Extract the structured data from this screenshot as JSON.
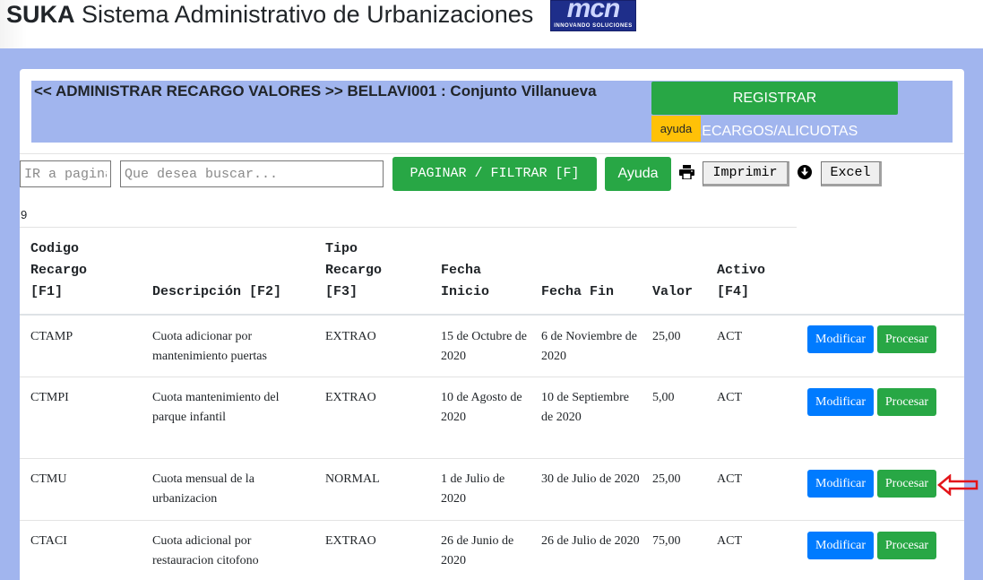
{
  "header": {
    "brand": "SUKA",
    "title": "Sistema Administrativo de Urbanizaciones",
    "logo_mark": "mcn",
    "logo_text": "INNOVANDO SOLUCIONES"
  },
  "banner": {
    "title": "<< ADMINISTRAR RECARGO VALORES >> BELLAVI001 : Conjunto Villanueva",
    "register_button": "REGISTRAR RECARGOS/ALICUOTAS",
    "help_badge": "ayuda"
  },
  "toolbar": {
    "page_placeholder": "IR a pagina",
    "search_placeholder": "Que desea buscar...",
    "paginate_button": "PAGINAR / FILTRAR [F]",
    "help_button": "Ayuda",
    "print_button": "Imprimir",
    "excel_button": "Excel"
  },
  "record_count": "9",
  "table": {
    "headers": {
      "codigo": [
        "Codigo",
        "Recargo",
        "[F1]"
      ],
      "descripcion": "Descripción [F2]",
      "tipo": [
        "Tipo",
        "Recargo",
        "[F3]"
      ],
      "fecha_inicio": [
        "Fecha",
        "Inicio"
      ],
      "fecha_fin": "Fecha Fin",
      "valor": "Valor",
      "activo": [
        "Activo",
        "[F4]"
      ]
    },
    "rows": [
      {
        "codigo": "CTAMP",
        "descripcion": "Cuota adicionar por mantenimiento puertas",
        "tipo": "EXTRAO",
        "inicio": "15 de Octubre de 2020",
        "fin": "6 de Noviembre de 2020",
        "valor": "25,00",
        "activo": "ACT"
      },
      {
        "codigo": "CTMPI",
        "descripcion": "Cuota mantenimiento del parque infantil",
        "tipo": "EXTRAO",
        "inicio": "10 de Agosto de 2020",
        "fin": "10 de Septiembre de 2020",
        "valor": "5,00",
        "activo": "ACT"
      },
      {
        "codigo": "CTMU",
        "descripcion": "Cuota mensual de la urbanizacion",
        "tipo": "NORMAL",
        "inicio": "1 de Julio de 2020",
        "fin": "30 de Julio de 2020",
        "valor": "25,00",
        "activo": "ACT"
      },
      {
        "codigo": "CTACI",
        "descripcion": "Cuota adicional por restauracion citofono",
        "tipo": "EXTRAO",
        "inicio": "26 de Junio de 2020",
        "fin": "26 de Julio de 2020",
        "valor": "75,00",
        "activo": "ACT"
      }
    ],
    "modify_label": "Modificar",
    "process_label": "Procesar"
  },
  "colors": {
    "blue_background": "#a1b5ee",
    "success_green": "#28a745",
    "primary_blue": "#007bff",
    "warning_yellow": "#ffc107",
    "pointer_red": "#e3151a"
  }
}
